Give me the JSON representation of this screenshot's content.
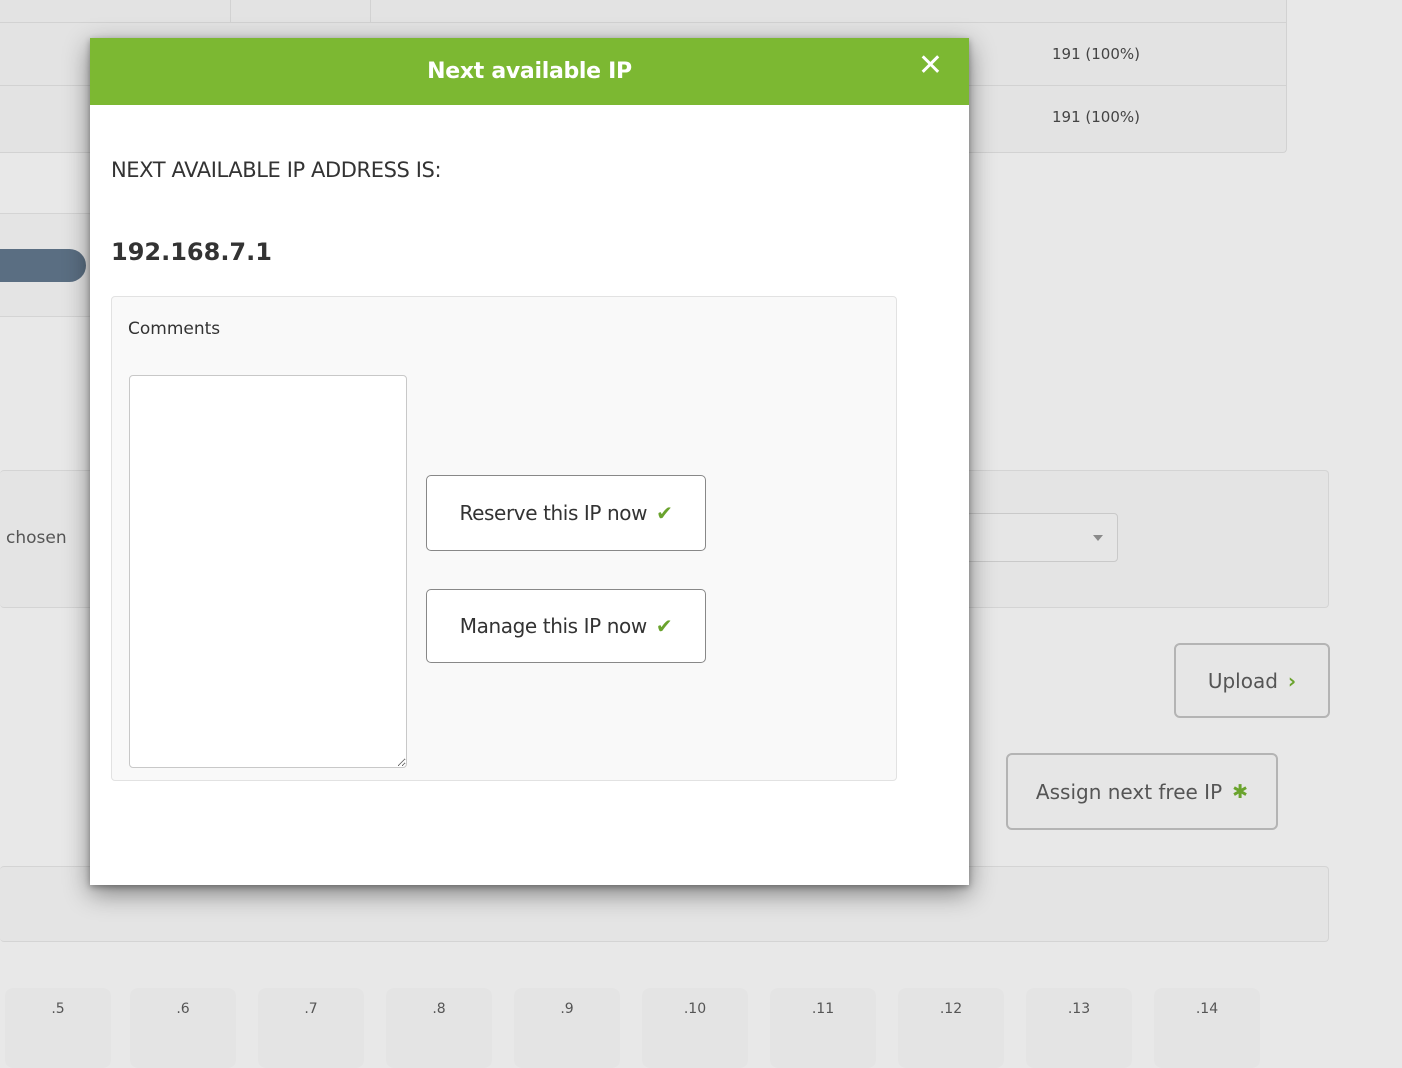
{
  "background": {
    "table": {
      "rows": [
        {
          "value": "191 (100%)"
        },
        {
          "value": "191 (100%)"
        }
      ]
    },
    "chosen_text": "chosen",
    "upload_button": {
      "label": "Upload",
      "icon": "chevron-right-icon"
    },
    "assign_button": {
      "label": "Assign next free IP",
      "icon": "gear-icon"
    },
    "ip_boxes": [
      ".5",
      ".6",
      ".7",
      ".8",
      ".9",
      ".10",
      ".11",
      ".12",
      ".13",
      ".14"
    ]
  },
  "modal": {
    "title": "Next available IP",
    "close_icon": "close-icon",
    "heading": "NEXT AVAILABLE IP ADDRESS IS:",
    "ip_address": "192.168.7.1",
    "comments": {
      "label": "Comments",
      "value": ""
    },
    "buttons": {
      "reserve": "Reserve this IP now",
      "manage": "Manage this IP now"
    }
  },
  "colors": {
    "accent": "#7cb832",
    "check": "#6aa32d"
  }
}
